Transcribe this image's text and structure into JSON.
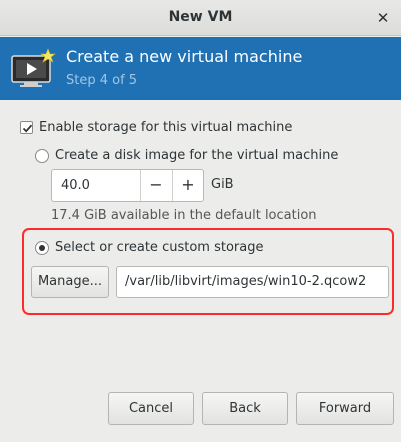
{
  "window": {
    "title": "New VM",
    "close_glyph": "✕"
  },
  "header": {
    "title": "Create a new virtual machine",
    "step": "Step 4 of 5",
    "icon": "vm-monitor-icon"
  },
  "storage": {
    "enable_label": "Enable storage for this virtual machine",
    "enable_checked": true,
    "create_disk_label": "Create a disk image for the virtual machine",
    "disk_size": "40.0",
    "minus": "−",
    "plus": "+",
    "unit": "GiB",
    "available": "17.4 GiB available in the default location",
    "custom_label": "Select or create custom storage",
    "custom_selected": true,
    "manage_label": "Manage...",
    "path": "/var/lib/libvirt/images/win10-2.qcow2"
  },
  "buttons": {
    "cancel": "Cancel",
    "back": "Back",
    "forward": "Forward"
  },
  "colors": {
    "header_bg": "#1f71b3",
    "highlight_border": "#ff2a2a"
  }
}
